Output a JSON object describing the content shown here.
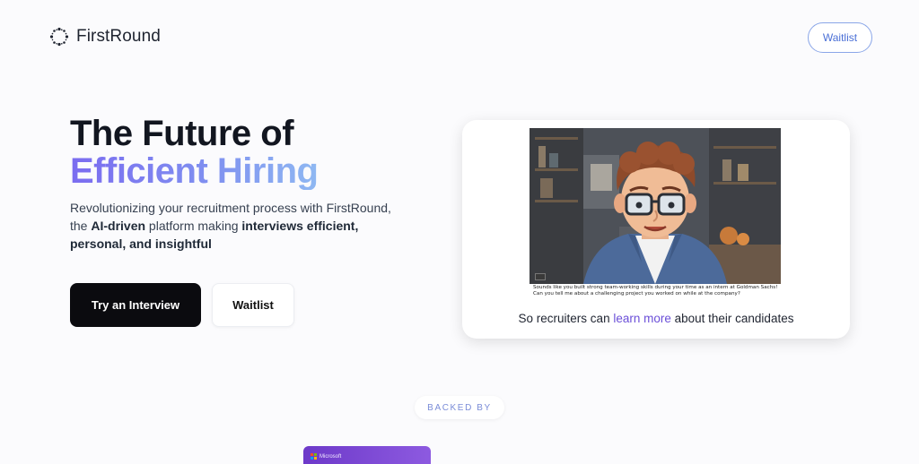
{
  "header": {
    "brand": "FirstRound",
    "waitlist_label": "Waitlist"
  },
  "hero": {
    "title_line1": "The Future of",
    "title_line2": "Efficient Hiring",
    "desc_part1": "Revolutionizing your recruitment process with FirstRound, the ",
    "desc_bold1": "AI-driven",
    "desc_part2": " platform making ",
    "desc_bold2": "interviews efficient, personal, and insightful",
    "primary_button": "Try an Interview",
    "secondary_button": "Waitlist"
  },
  "demo": {
    "caption": "Sounds like you built strong team-working skills during your time as an intern at Goldman Sachs! Can you tell me about a challenging project you worked on while at the company?",
    "tagline_pre": "So recruiters can ",
    "tagline_highlight": "learn more",
    "tagline_post": " about their candidates"
  },
  "backed": {
    "label": "BACKED BY",
    "investor_name": "Microsoft"
  },
  "colors": {
    "accent_purple": "#6b4fd8",
    "gradient_start": "#7b6cf0",
    "gradient_end": "#8fb8f2",
    "primary_button": "#0b0b0f"
  }
}
